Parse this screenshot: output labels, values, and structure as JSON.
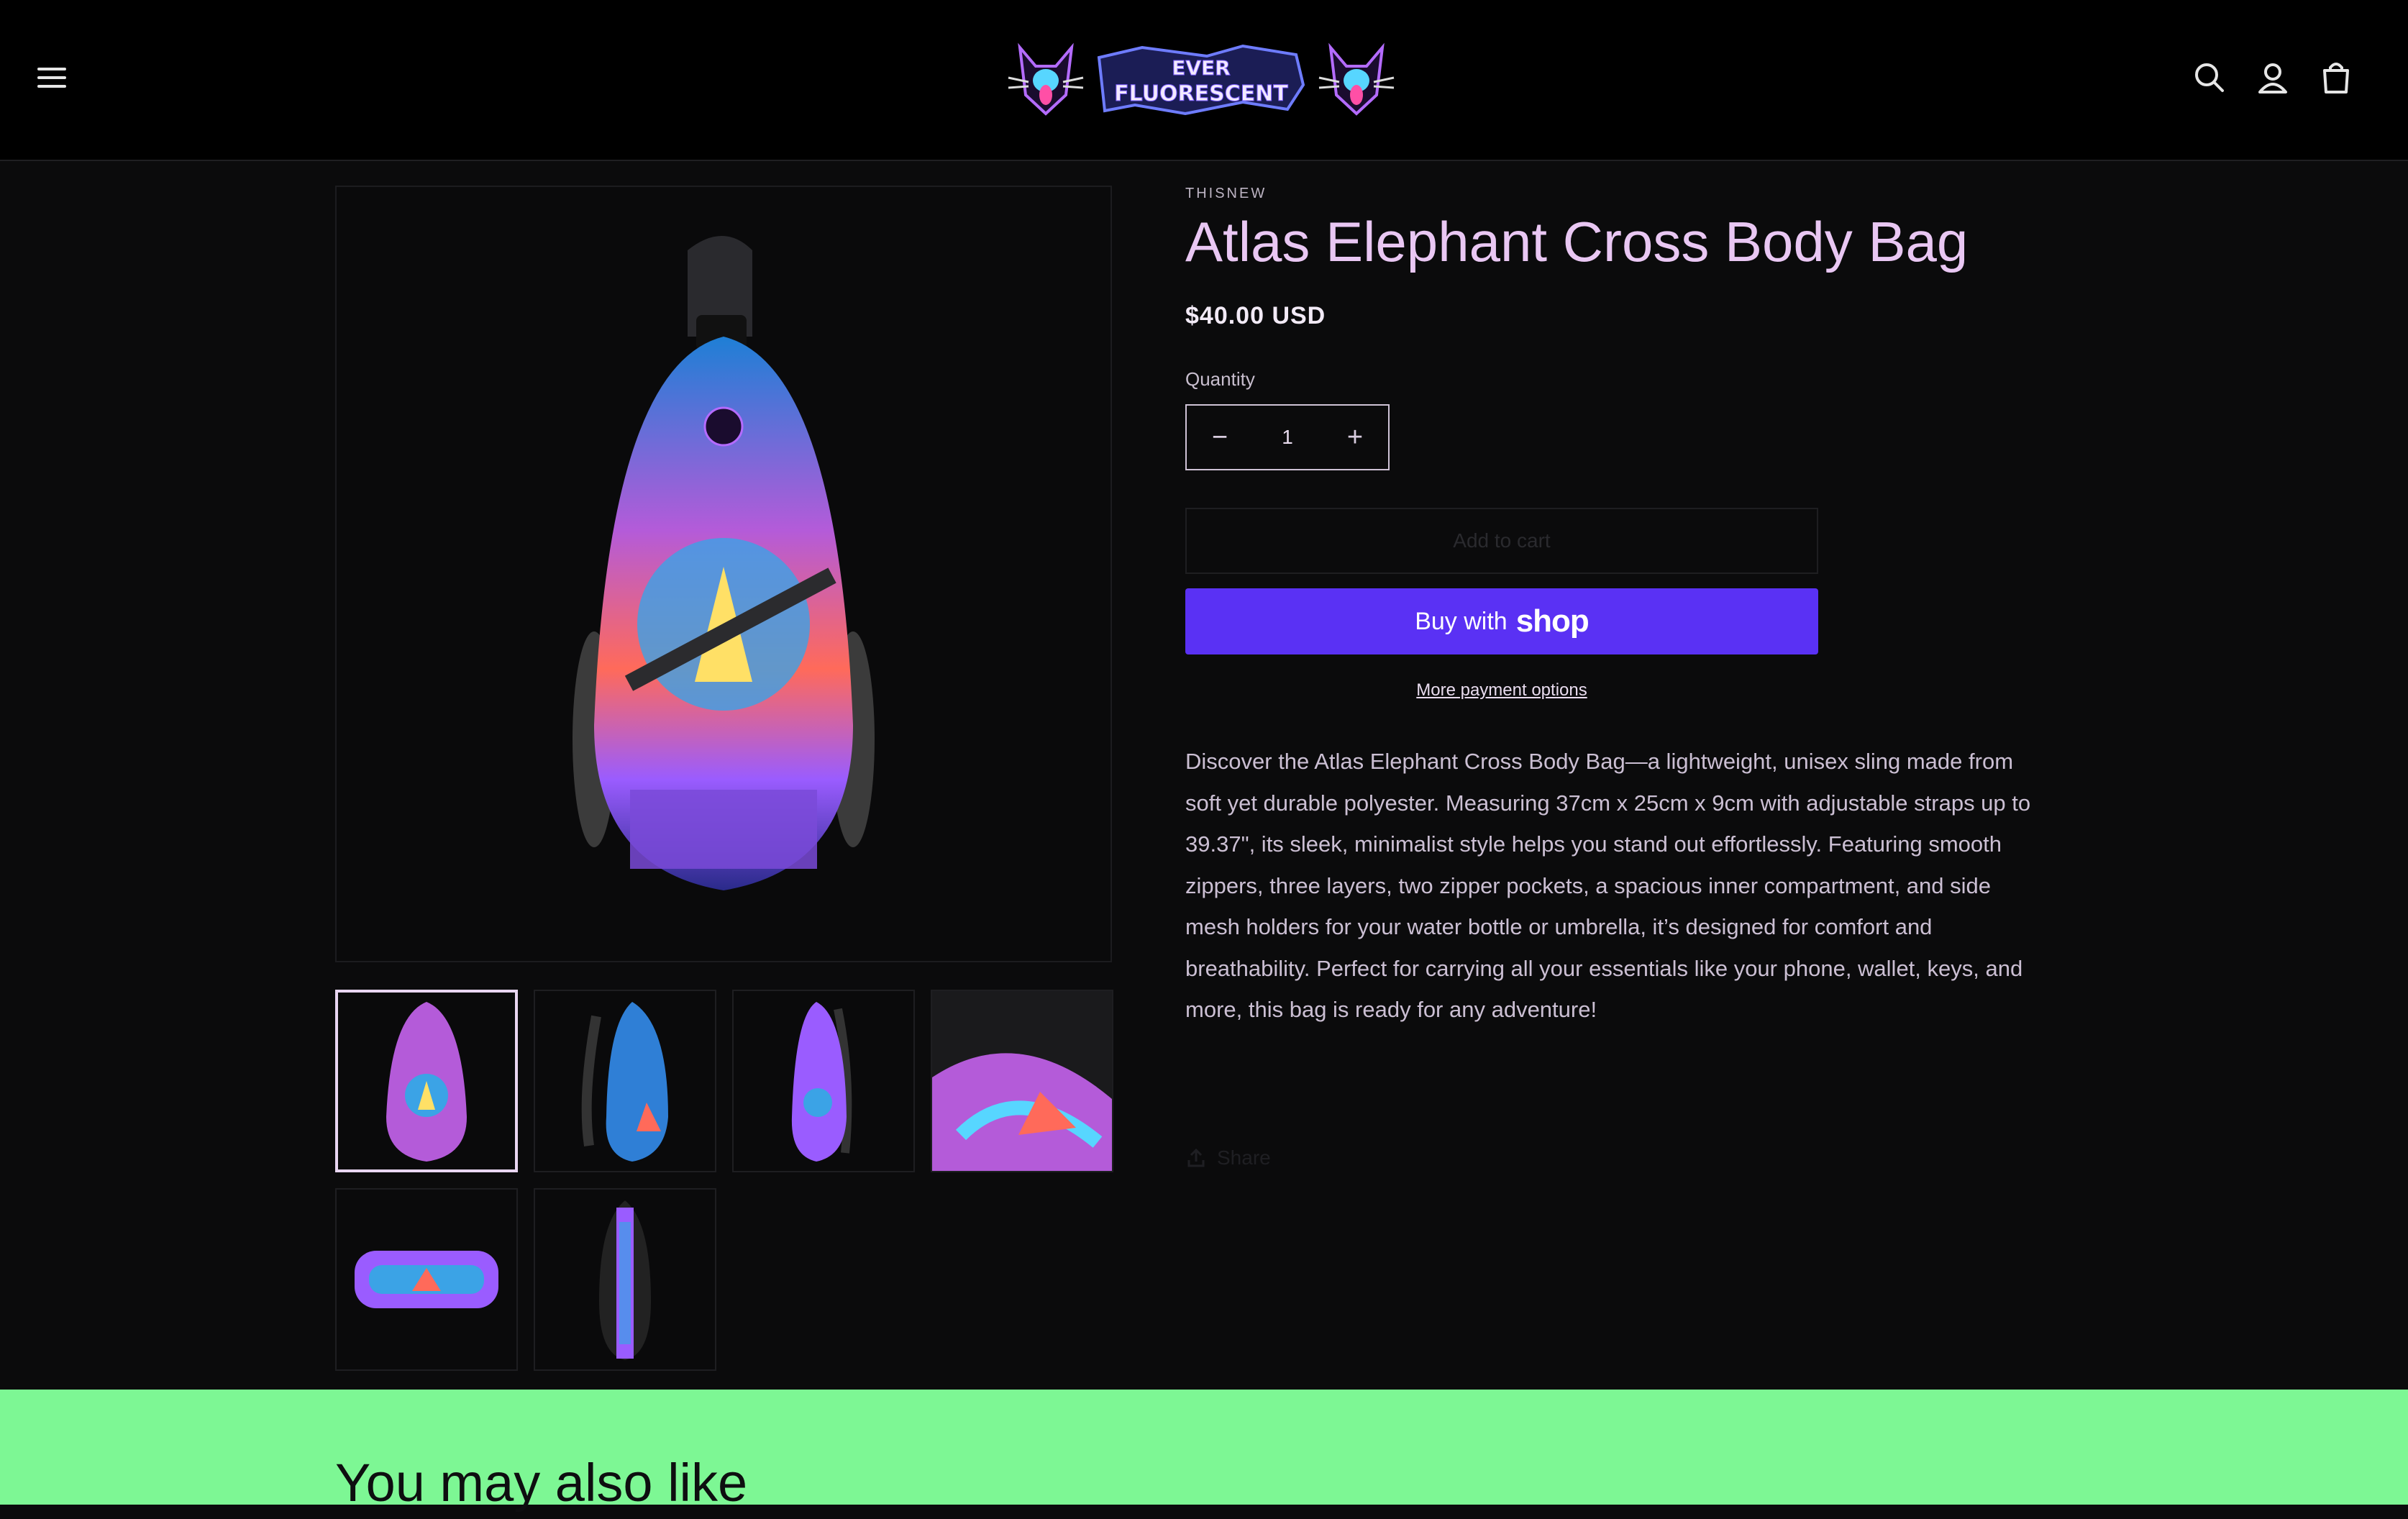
{
  "header": {
    "logo_text_line1": "EVER",
    "logo_text_line2": "FLUORESCENT",
    "menu_icon": "hamburger-menu-icon",
    "search_icon": "search-icon",
    "account_icon": "account-icon",
    "cart_icon": "cart-icon"
  },
  "product": {
    "vendor": "THISNEW",
    "title": "Atlas Elephant Cross Body Bag",
    "price": "$40.00 USD",
    "quantity_label": "Quantity",
    "quantity_value": "1",
    "decrease_symbol": "−",
    "increase_symbol": "+",
    "add_to_cart": "Add to cart",
    "buy_with": "Buy with",
    "shop_word": "shop",
    "more_payment_options": "More payment options",
    "description": "Discover the Atlas Elephant Cross Body Bag—a lightweight, unisex sling made from soft yet durable polyester. Measuring 37cm x 25cm x 9cm with adjustable straps up to 39.37\", its sleek, minimalist style helps you stand out effortlessly. Featuring smooth zippers, three layers, two zipper pockets, a spacious inner compartment, and side mesh holders for your water bottle or umbrella, it’s designed for comfort and breathability. Perfect for carrying all your essentials like your phone, wallet, keys, and more, this bag is ready for any adventure!",
    "share": "Share"
  },
  "gallery": {
    "thumbnail_count": 6,
    "active_thumbnail": 1
  },
  "related": {
    "title": "You may also like"
  },
  "colors": {
    "background": "#0b0b0c",
    "header": "#000000",
    "title": "#e9c7f3",
    "shop_button": "#5a31f4",
    "related_band": "#7df794"
  }
}
